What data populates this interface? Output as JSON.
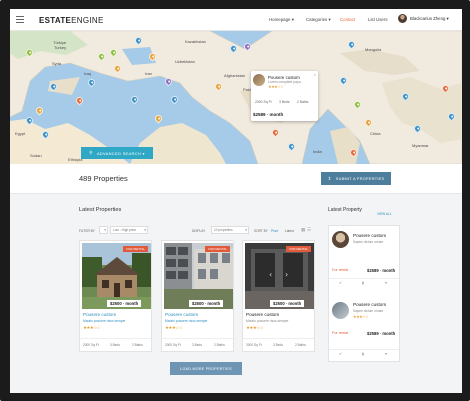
{
  "header": {
    "logo_main": "ESTATE",
    "logo_sub": "ENGINE",
    "nav": [
      {
        "label": "Homepage ▾",
        "active": false
      },
      {
        "label": "Categories ▾",
        "active": false
      },
      {
        "label": "Contact",
        "active": true
      },
      {
        "label": "List Users",
        "active": false
      }
    ],
    "user_name": "Blackcarius Zheng ▾"
  },
  "map": {
    "labels": [
      "Türkiye",
      "Turkey",
      "Syria",
      "Iraq",
      "Iran",
      "Egypt",
      "Afghanistan",
      "Pakistan",
      "India",
      "China",
      "Mongolia",
      "Kazakhstan",
      "Uzbekistan",
      "Sudan",
      "Ethiopia",
      "Myanmar"
    ],
    "popup": {
      "title": "Pousere custom",
      "location": "Lorem complete pays...",
      "stars": "★★★☆☆",
      "sqft": "2000 Sq Ft",
      "beds": "3 Beds",
      "baths": "2 Baths",
      "price": "$2589 · month",
      "close": "×"
    },
    "advanced_search": "ADVANCED SEARCH ▾"
  },
  "listing": {
    "count": "489 Properties",
    "submit_label": "SUBMIT A PROPERTIES",
    "latest_title": "Latest Properties",
    "filters": {
      "filter_by": "FILTER BY",
      "price_range": "Low - High price",
      "display_label": "DISPLAY",
      "display_value": "10 properties",
      "sort_label": "SORT BY",
      "sort_a": "Price",
      "sort_b": "Latest"
    },
    "cards": [
      {
        "badge": "FOR RENTAL",
        "price": "$2500 · month",
        "name": "Pousere custom",
        "addr": "Mauris posuere risus semper",
        "stars": "★★★☆☆",
        "sqft": "2000 Sq Ft",
        "beds": "3 Beds",
        "baths": "2 Baths"
      },
      {
        "badge": "FOR RENTAL",
        "price": "$2500 · month",
        "name": "Pousere custom",
        "addr": "Mauris posuere risus semper",
        "stars": "★★★☆☆",
        "sqft": "2000 Sq Ft",
        "beds": "3 Beds",
        "baths": "2 Baths"
      },
      {
        "badge": "FOR RENTAL",
        "price": "$2500 · month",
        "name": "Pousere custom",
        "addr": "Mauris posuere risus semper",
        "stars": "★★★☆☆",
        "sqft": "2000 Sq Ft",
        "beds": "3 Beds",
        "baths": "2 Baths"
      }
    ],
    "load_more": "LOAD MORE PROPERTIES"
  },
  "sidebar": {
    "title": "Latest Property",
    "view_all": "VIEW ALL",
    "items": [
      {
        "title": "Pousere custom",
        "addr": "Sapien dictum ornare",
        "rent": "For rental",
        "price": "$2589 · month"
      },
      {
        "title": "Pousere custom",
        "addr": "Sapien dictum ornare",
        "stars": "★★★☆☆",
        "rent": "For rental",
        "price": "$2589 · month"
      }
    ]
  },
  "colors": {
    "accent_orange": "#e36a3b",
    "search_blue": "#2fa8c6",
    "button_blue": "#4d7e9c",
    "link_blue": "#2f8fc0",
    "badge_red": "#e15a3b"
  }
}
